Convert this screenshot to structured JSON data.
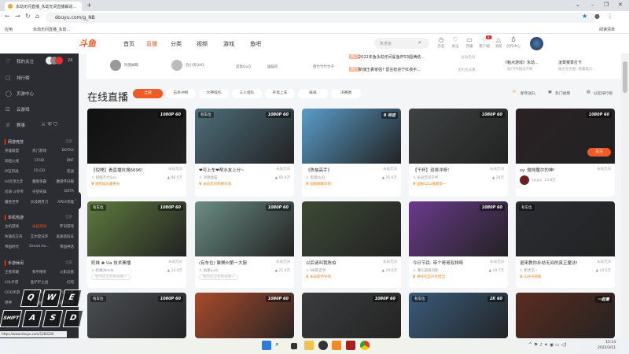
{
  "browser": {
    "tab_title": "永劫无间直播_永劫无间直播解说...",
    "new_tab": "+",
    "url": "douyu.com/g_NB",
    "bookmarks": [
      {
        "label": "应用"
      },
      {
        "label": "永劫无间直播_永劫..."
      }
    ],
    "reading_list": "阅读清单"
  },
  "header": {
    "logo": "斗鱼",
    "nav": [
      "首页",
      "直播",
      "分类",
      "视频",
      "游戏",
      "鱼吧"
    ],
    "active_nav": "直播",
    "search_placeholder": "朱老板",
    "icons": [
      {
        "icon": "clock-icon",
        "label": "历史"
      },
      {
        "icon": "heart-icon",
        "label": "关注"
      },
      {
        "icon": "camera-icon",
        "label": "开播"
      },
      {
        "icon": "chat-icon",
        "label": "客户端",
        "badge": "8"
      },
      {
        "icon": "bell-icon",
        "label": "消息"
      },
      {
        "icon": "bulb-icon",
        "label": "创作中心"
      }
    ]
  },
  "sidebar": {
    "items": [
      {
        "icon": "heart-icon",
        "label": "我的关注",
        "count": "24"
      },
      {
        "icon": "rank-icon",
        "label": "排行榜"
      },
      {
        "icon": "gamepad-icon",
        "label": "页游中心"
      },
      {
        "icon": "cloud-game-icon",
        "label": "云游戏"
      },
      {
        "icon": "trophy-icon",
        "label": "赛事"
      }
    ],
    "sections": [
      {
        "title": "网游竞技",
        "all": "全部",
        "games": [
          "英雄联盟",
          "热门游戏",
          "DOTA2",
          "穿越火线",
          "CFHD",
          "DNF",
          "IP石邦战",
          "CS:GO",
          "逆战",
          "lol云顶之弈",
          "魔兽争霸",
          "魔兽怀旧服",
          "问道·斗罗传",
          "守望先锋",
          "DOTA",
          "魔兽世界",
          "天涯明月刀",
          "APEX英雄"
        ]
      },
      {
        "title": "单机热游",
        "all": "全部",
        "games": [
          "主机游戏",
          "永劫无间",
          "怀旧游戏",
          "失落的方舟",
          "艾尔登法环",
          "逃离塔科夫",
          "帝国时代",
          "Dread Hu...",
          "帝国神话"
        ],
        "active": "永劫无间"
      },
      {
        "title": "手游休闲",
        "all": "全部",
        "games": [
          "王者荣耀",
          "和平精英",
          "火影忍者",
          "LOL手游",
          "金铲铲之战",
          "幻塔",
          "COD手游",
          "第五人格",
          "CF手游",
          "原神",
          "斗鱼吧",
          "天涯明月刀"
        ]
      }
    ],
    "status_url": "https://www.douyu.com/1260240"
  },
  "recommend": {
    "streamers": [
      "阿帽蝴蝶",
      "泡小贤QAQ",
      "思意QuQ",
      "幽猫阿",
      "西竹竹竹竹子"
    ],
    "news": [
      {
        "tag": "热门",
        "text": "2022年鱼永劫无间鲨鱼杯S3圆满结...",
        "src": "永劫无间"
      },
      {
        "tag": "热门",
        "text": "新魂王裹家强? 留言抢进宁红夜手...",
        "src": "主机也派遣"
      }
    ],
    "events": [
      {
        "title": "《魁点游戏》永劫...",
        "sub": "旗门PK随选不断"
      },
      {
        "title": "凌霄赛季打卡",
        "sub": "报名任务题, 暴露展示..."
      }
    ]
  },
  "main": {
    "title": "在线直播",
    "filters": [
      "全部",
      "击杀冲榜",
      "大神操作",
      "三人组队",
      "开黑上车",
      "妹纸",
      "决赛圈"
    ],
    "active_filter": "全部",
    "tools": [
      "新年送礼",
      "热门视频",
      "分区排行榜"
    ],
    "cards": [
      {
        "title": "【倪哩】看直播抗搜6696!",
        "game": "永劫无间",
        "streamer": "倪哩不大Sao",
        "heat": "96.5万",
        "tag": "颁奖娱乐董事长",
        "quality": "1080P 60",
        "badge": "",
        "thumb": "#101010"
      },
      {
        "title": "❤可上车❤帮水友上分~",
        "game": "永劫无间",
        "streamer": "功德能猫",
        "heat": "60.4万",
        "tag": "永劫无间荣耀天海",
        "quality": "1080P 60",
        "badge": "有车位",
        "thumb": "#4d6e7b"
      },
      {
        "title": "《陈抽高手》",
        "game": "永劫无间",
        "streamer": "思意QuQ",
        "heat": "35.6万",
        "tag": "国服巅峰双刺",
        "quality": "9 待选",
        "badge": "",
        "thumb": "#5a9cc9"
      },
      {
        "title": "【千杯】双排冲呀!",
        "game": "永劫无间",
        "streamer": "永劫无间千杯",
        "heat": "28万",
        "tag": "国服S2山鬼巅第一",
        "quality": "1080P 60",
        "badge": "",
        "thumb": "#3e4242"
      },
      {
        "title": "sy: 微排魔尔的神!",
        "game": "永劫无间",
        "streamer": "syuyu",
        "heat": "13.4万",
        "tag": "",
        "follow": "关注",
        "quality": "1080P 60",
        "badge": "",
        "thumb": "#2a2124"
      },
      {
        "title": "奶妹 ❀ Ua 技术寨播",
        "game": "永劫无间",
        "streamer": "奶嘴冰milk",
        "heat": "23.4万",
        "tag": "暂时还没有称号哦~",
        "gray": true,
        "quality": "1080P 60",
        "badge": "有车位",
        "thumb": "#5e7a3e"
      },
      {
        "title": "(有车位) 聚樂州第一大厨",
        "game": "永劫无间",
        "streamer": "幼患Luck",
        "heat": "21.4万",
        "tag": "暂时还没有称号哦~",
        "gray": true,
        "quality": "1080P 60",
        "badge": "",
        "thumb": "#6b8d84"
      },
      {
        "title": "以后请叫我陈伯",
        "game": "永劫无间",
        "streamer": "NB陈定手",
        "heat": "19.6万",
        "tag": "永劫新手导师",
        "quality": "",
        "badge": "",
        "thumb": "#3d4a36"
      },
      {
        "title": "今日节目: 带个哥哥双排呀",
        "game": "永劫无间",
        "streamer": "薄头超级刘能",
        "heat": "19.7万",
        "tag": "峡谷吃自声优担当",
        "quality": "1080P 60",
        "badge": "",
        "thumb": "#6a3a8c"
      },
      {
        "title": "退来教你永劫无间的真正魔法!",
        "game": "永劫无间",
        "streamer": "影虎堂~",
        "heat": "19.5万",
        "tag": "山谷天花板",
        "quality": "",
        "badge": "有车位",
        "thumb": "#2a2d33"
      },
      {
        "quality": "1080P 60",
        "badge": "有车位",
        "thumb": "#4a4e52"
      },
      {
        "quality": "1080P 60",
        "badge": "",
        "thumb": "#a84a2c"
      },
      {
        "quality": "1080P 60",
        "badge": "",
        "thumb": "#3b3c3e"
      },
      {
        "quality": "2K 60",
        "badge": "有车位",
        "thumb": "#3a5a7a"
      },
      {
        "quality": "一起看",
        "badge": "",
        "thumb": "#5a2d20"
      }
    ]
  },
  "keyboard_overlay": [
    "Q",
    "W",
    "E",
    "SHIFT",
    "A",
    "S",
    "D"
  ],
  "taskbar": {
    "time": "15:14",
    "date": "2022/3/11"
  }
}
